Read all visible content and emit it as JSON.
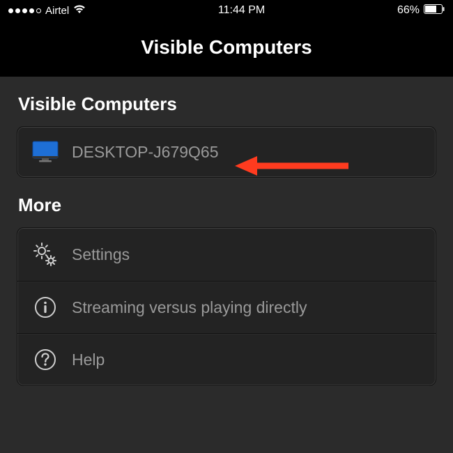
{
  "status_bar": {
    "carrier": "Airtel",
    "time": "11:44 PM",
    "battery_percent": "66%"
  },
  "header": {
    "title": "Visible Computers"
  },
  "sections": {
    "visible_computers": {
      "title": "Visible Computers",
      "items": [
        {
          "label": "DESKTOP-J679Q65"
        }
      ]
    },
    "more": {
      "title": "More",
      "items": [
        {
          "label": "Settings"
        },
        {
          "label": "Streaming versus playing directly"
        },
        {
          "label": "Help"
        }
      ]
    }
  },
  "annotation": {
    "arrow_color": "#ff3b1f"
  }
}
